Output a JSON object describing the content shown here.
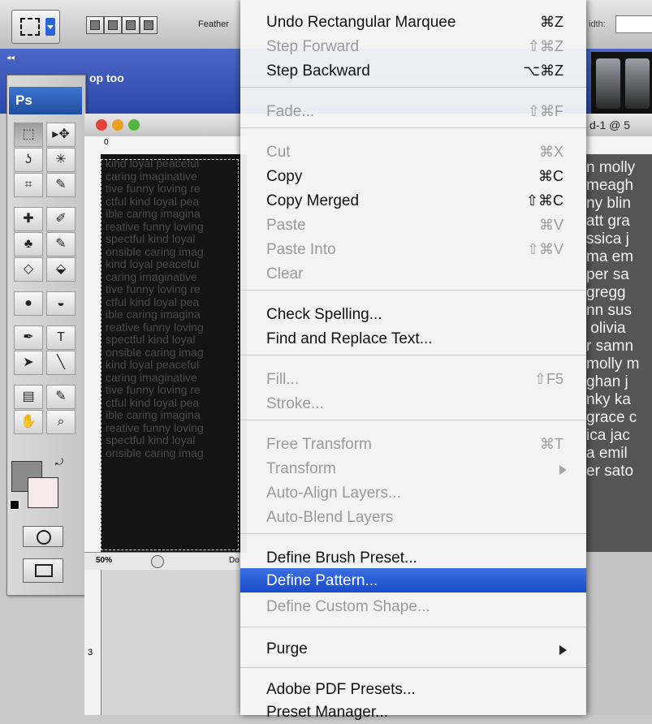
{
  "options_bar": {
    "feather_label": "Feather",
    "width_label": "idth:"
  },
  "panel": {
    "title": "op too",
    "collapse": "◂◂"
  },
  "tools": {
    "logo": "Ps",
    "rows": [
      [
        "⬚",
        "▸✥"
      ],
      [
        "ʖ",
        "✳"
      ],
      [
        "⌗",
        "✎"
      ],
      [
        "✚",
        "✐"
      ],
      [
        "♣",
        "✎"
      ],
      [
        "◇",
        "⬙"
      ],
      [
        "●",
        "◒"
      ],
      [
        "✒",
        "T"
      ],
      [
        "➤",
        "╲"
      ],
      [
        "▤",
        "✎"
      ],
      [
        "✋",
        "⌕"
      ]
    ]
  },
  "document": {
    "ruler_zero": "0",
    "lines": [
      "kind loyal peaceful",
      "caring imaginative",
      "tive funny loving re",
      "ctful kind loyal pea",
      "ible caring imagina",
      "reative funny loving",
      "spectful kind loyal",
      "onsible caring imag",
      "kind loyal peaceful",
      "caring imaginative",
      "tive funny loving re",
      "ctful kind loyal pea",
      "ible caring imagina",
      "reative funny loving",
      "spectful kind loyal",
      "onsible caring imag",
      "kind loyal peaceful",
      "caring imaginative",
      "tive funny loving re",
      "ctful kind loyal pea",
      "ible caring imagina",
      "reative funny loving",
      "spectful kind loyal",
      "onsible caring imag"
    ],
    "zoom": "50%",
    "status_doc": "Do",
    "lower_ruler_label": "3"
  },
  "right_document": {
    "title": "d-1 @ 5",
    "lines": [
      "n molly",
      "meagh",
      "ny blin",
      "att gra",
      "ssica j",
      "ma em",
      "per sa",
      "gregg",
      "nn sus",
      " olivia",
      "r samn",
      "molly m",
      "ghan j",
      "nky ka",
      "grace c",
      "ica jac",
      "a emil",
      "er sato"
    ]
  },
  "edit_menu": {
    "items": [
      {
        "label": "Undo Rectangular Marquee",
        "shortcut": "⌘Z",
        "disabled": false
      },
      {
        "label": "Step Forward",
        "shortcut": "⇧⌘Z",
        "disabled": true
      },
      {
        "label": "Step Backward",
        "shortcut": "⌥⌘Z",
        "disabled": false
      },
      {
        "label": "Fade...",
        "shortcut": "⇧⌘F",
        "disabled": true
      },
      {
        "label": "Cut",
        "shortcut": "⌘X",
        "disabled": true
      },
      {
        "label": "Copy",
        "shortcut": "⌘C",
        "disabled": false
      },
      {
        "label": "Copy Merged",
        "shortcut": "⇧⌘C",
        "disabled": false
      },
      {
        "label": "Paste",
        "shortcut": "⌘V",
        "disabled": true
      },
      {
        "label": "Paste Into",
        "shortcut": "⇧⌘V",
        "disabled": true
      },
      {
        "label": "Clear",
        "shortcut": "",
        "disabled": true
      },
      {
        "label": "Check Spelling...",
        "shortcut": "",
        "disabled": false
      },
      {
        "label": "Find and Replace Text...",
        "shortcut": "",
        "disabled": false
      },
      {
        "label": "Fill...",
        "shortcut": "⇧F5",
        "disabled": true
      },
      {
        "label": "Stroke...",
        "shortcut": "",
        "disabled": true
      },
      {
        "label": "Free Transform",
        "shortcut": "⌘T",
        "disabled": true
      },
      {
        "label": "Transform",
        "shortcut": "",
        "disabled": true,
        "submenu": true
      },
      {
        "label": "Auto-Align Layers...",
        "shortcut": "",
        "disabled": true
      },
      {
        "label": "Auto-Blend Layers",
        "shortcut": "",
        "disabled": true
      },
      {
        "label": "Define Brush Preset...",
        "shortcut": "",
        "disabled": false
      },
      {
        "label": "Define Pattern...",
        "shortcut": "",
        "disabled": false,
        "highlighted": true
      },
      {
        "label": "Define Custom Shape...",
        "shortcut": "",
        "disabled": true
      },
      {
        "label": "Purge",
        "shortcut": "",
        "disabled": false,
        "submenu": true
      },
      {
        "label": "Adobe PDF Presets...",
        "shortcut": "",
        "disabled": false
      },
      {
        "label": "Preset Manager...",
        "shortcut": "",
        "disabled": false
      }
    ]
  },
  "colors": {
    "highlight": "#1a4bc9",
    "foreground": "#8b8b8b",
    "background": "#f7e9e9"
  }
}
